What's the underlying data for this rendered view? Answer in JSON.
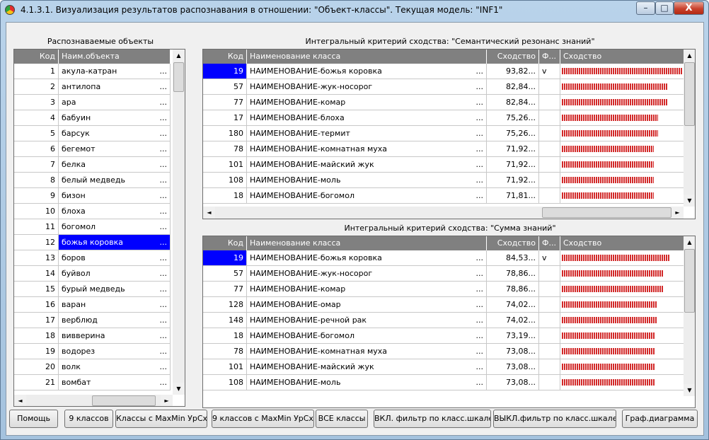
{
  "window": {
    "title": "4.1.3.1. Визуализация результатов распознавания в отношении: \"Объект-классы\". Текущая модель: \"INF1\"",
    "controls": {
      "minimize": "–",
      "maximize": "□",
      "close": "X"
    }
  },
  "objects_panel": {
    "caption": "Распознаваемые объекты",
    "headers": {
      "code": "Код",
      "name": "Наим.объекта"
    },
    "dots": "...",
    "rows": [
      {
        "code": "1",
        "name": "акула-катран"
      },
      {
        "code": "2",
        "name": "антилопа"
      },
      {
        "code": "3",
        "name": "ара"
      },
      {
        "code": "4",
        "name": "бабуин"
      },
      {
        "code": "5",
        "name": "барсук"
      },
      {
        "code": "6",
        "name": "бегемот"
      },
      {
        "code": "7",
        "name": "белка"
      },
      {
        "code": "8",
        "name": "белый медведь"
      },
      {
        "code": "9",
        "name": "бизон"
      },
      {
        "code": "10",
        "name": "блоха"
      },
      {
        "code": "11",
        "name": "богомол"
      },
      {
        "code": "12",
        "name": "божья коровка",
        "selected": true
      },
      {
        "code": "13",
        "name": "боров"
      },
      {
        "code": "14",
        "name": "буйвол"
      },
      {
        "code": "15",
        "name": "бурый медведь"
      },
      {
        "code": "16",
        "name": "варан"
      },
      {
        "code": "17",
        "name": "верблюд"
      },
      {
        "code": "18",
        "name": "вивверина"
      },
      {
        "code": "19",
        "name": "водорез"
      },
      {
        "code": "20",
        "name": "волк"
      },
      {
        "code": "21",
        "name": "вомбат"
      }
    ]
  },
  "semantic_panel": {
    "caption": "Интегральный критерий сходства: \"Семантический резонанс знаний\"",
    "headers": {
      "code": "Код",
      "name": "Наименование класса",
      "similarity": "Сходство",
      "flag": "Ф...",
      "bar": "Сходство"
    },
    "rows": [
      {
        "code": "19",
        "name": "НАИМЕНОВАНИЕ-божья коровка",
        "similarity": "93,82...",
        "flag": "v",
        "fill": 0.9382,
        "selected": true
      },
      {
        "code": "57",
        "name": "НАИМЕНОВАНИЕ-жук-носорог",
        "similarity": "82,84...",
        "flag": "",
        "fill": 0.8284
      },
      {
        "code": "77",
        "name": "НАИМЕНОВАНИЕ-комар",
        "similarity": "82,84...",
        "flag": "",
        "fill": 0.8284
      },
      {
        "code": "17",
        "name": "НАИМЕНОВАНИЕ-блоха",
        "similarity": "75,26...",
        "flag": "",
        "fill": 0.7526
      },
      {
        "code": "180",
        "name": "НАИМЕНОВАНИЕ-термит",
        "similarity": "75,26...",
        "flag": "",
        "fill": 0.7526
      },
      {
        "code": "78",
        "name": "НАИМЕНОВАНИЕ-комнатная муха",
        "similarity": "71,92...",
        "flag": "",
        "fill": 0.7192
      },
      {
        "code": "101",
        "name": "НАИМЕНОВАНИЕ-майский жук",
        "similarity": "71,92...",
        "flag": "",
        "fill": 0.7192
      },
      {
        "code": "108",
        "name": "НАИМЕНОВАНИЕ-моль",
        "similarity": "71,92...",
        "flag": "",
        "fill": 0.7192
      },
      {
        "code": "18",
        "name": "НАИМЕНОВАНИЕ-богомол",
        "similarity": "71,81...",
        "flag": "",
        "fill": 0.7181
      }
    ]
  },
  "sum_panel": {
    "caption": "Интегральный критерий сходства: \"Сумма знаний\"",
    "headers": {
      "code": "Код",
      "name": "Наименование класса",
      "similarity": "Сходство",
      "flag": "Ф...",
      "bar": "Сходство"
    },
    "rows": [
      {
        "code": "19",
        "name": "НАИМЕНОВАНИЕ-божья коровка",
        "similarity": "84,53...",
        "flag": "v",
        "fill": 0.8453,
        "selected": true
      },
      {
        "code": "57",
        "name": "НАИМЕНОВАНИЕ-жук-носорог",
        "similarity": "78,86...",
        "flag": "",
        "fill": 0.7886
      },
      {
        "code": "77",
        "name": "НАИМЕНОВАНИЕ-комар",
        "similarity": "78,86...",
        "flag": "",
        "fill": 0.7886
      },
      {
        "code": "128",
        "name": "НАИМЕНОВАНИЕ-омар",
        "similarity": "74,02...",
        "flag": "",
        "fill": 0.7402
      },
      {
        "code": "148",
        "name": "НАИМЕНОВАНИЕ-речной рак",
        "similarity": "74,02...",
        "flag": "",
        "fill": 0.7402
      },
      {
        "code": "18",
        "name": "НАИМЕНОВАНИЕ-богомол",
        "similarity": "73,19...",
        "flag": "",
        "fill": 0.7319
      },
      {
        "code": "78",
        "name": "НАИМЕНОВАНИЕ-комнатная муха",
        "similarity": "73,08...",
        "flag": "",
        "fill": 0.7308
      },
      {
        "code": "101",
        "name": "НАИМЕНОВАНИЕ-майский жук",
        "similarity": "73,08...",
        "flag": "",
        "fill": 0.7308
      },
      {
        "code": "108",
        "name": "НАИМЕНОВАНИЕ-моль",
        "similarity": "73,08...",
        "flag": "",
        "fill": 0.7308
      }
    ]
  },
  "buttons": {
    "help": "Помощь",
    "nine_classes": "9 классов",
    "maxmin_classes": "Классы с MaxMin УрСх",
    "nine_maxmin": "9 классов с MaxMin УрСх",
    "all_classes": "ВСЕ классы",
    "filter_on": "ВКЛ. фильтр по класс.шкале",
    "filter_off": "ВЫКЛ.фильтр по класс.шкале",
    "chart": "Граф.диаграмма"
  },
  "icons": {
    "scroll_up": "▲",
    "scroll_down": "▼",
    "scroll_left": "◄",
    "scroll_right": "►"
  },
  "colors": {
    "selection": "#0000ff",
    "bar": "#d22a2a",
    "header": "#808080"
  }
}
